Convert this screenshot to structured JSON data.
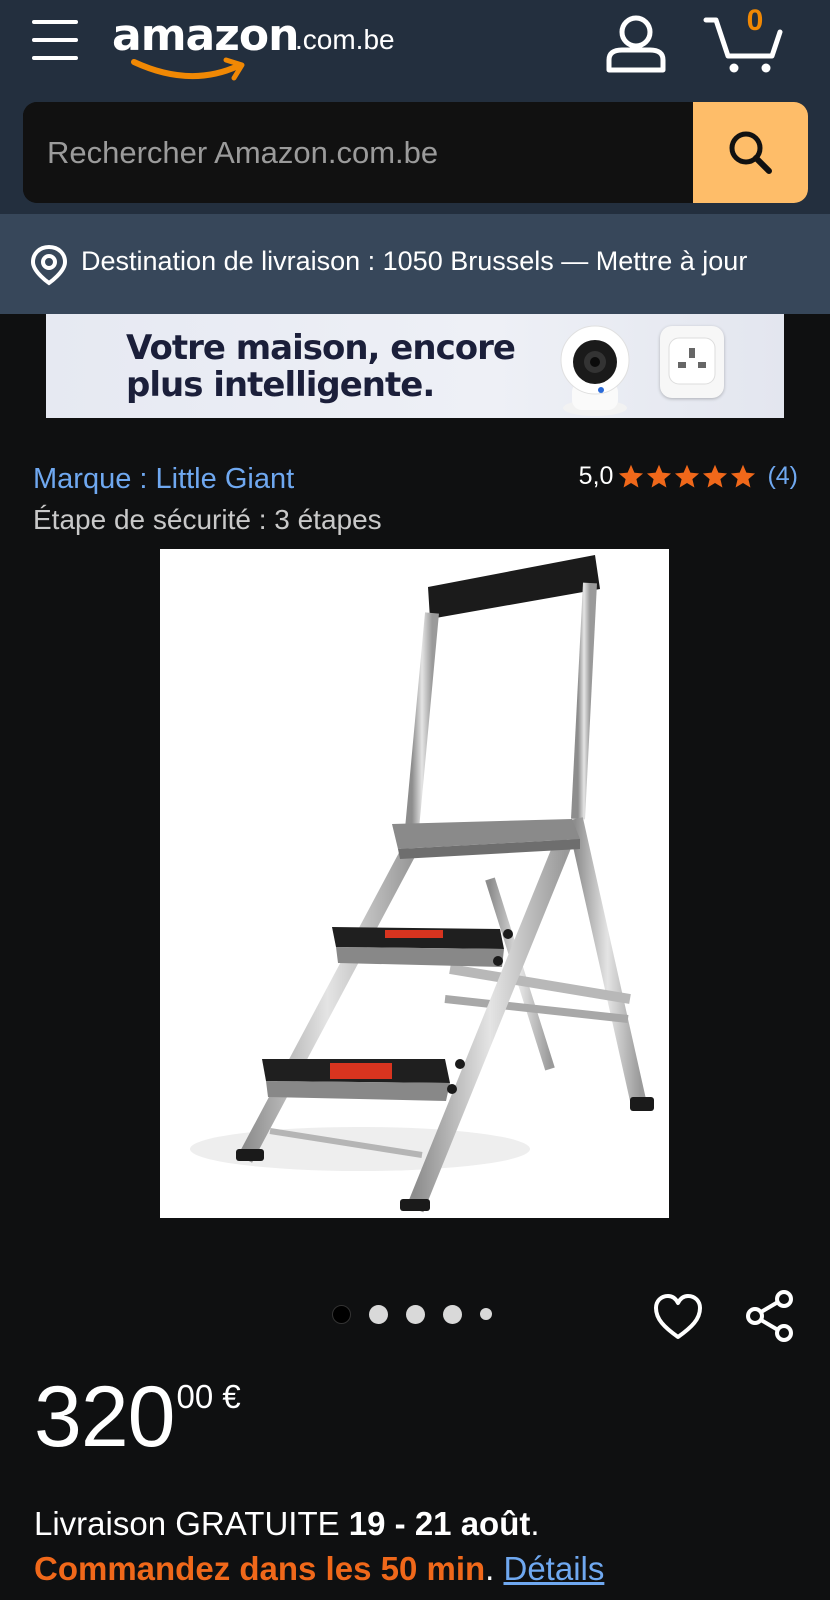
{
  "header": {
    "menu_icon": "hamburger-menu-icon",
    "logo_text": "amazon",
    "logo_suffix": ".com.be",
    "account_icon": "account-person-icon",
    "cart_icon": "shopping-cart-icon",
    "cart_count": "0"
  },
  "search": {
    "placeholder": "Rechercher Amazon.com.be",
    "button_icon": "search-icon"
  },
  "delivery_bar": {
    "icon": "location-pin-icon",
    "text": "Destination de livraison : 1050 Brussels — Mettre à jour"
  },
  "banner": {
    "text": "Votre maison, encore plus intelligente."
  },
  "product": {
    "brand_link": "Marque : Little Giant",
    "rating_value": "5,0",
    "rating_stars": 5,
    "rating_count": "(4)",
    "safety_step": "Étape de sécurité : 3 étapes",
    "image_count": 5,
    "active_image": 1
  },
  "actions": {
    "wishlist_icon": "heart-icon",
    "share_icon": "share-icon"
  },
  "price": {
    "whole": "320",
    "fraction": "00 €"
  },
  "delivery": {
    "prefix": "Livraison GRATUITE ",
    "dates": "19 - 21 août",
    "suffix": ".",
    "order_text": "Commandez dans les 50 min",
    "order_suffix": ". ",
    "details_link": "Détails"
  },
  "colors": {
    "header_bg": "#232f3e",
    "delivery_bar_bg": "#37475a",
    "search_button": "#febd69",
    "cart_count": "#f08804",
    "link": "#6fa8f0",
    "star": "#f0681a",
    "urgency": "#f0681a"
  }
}
